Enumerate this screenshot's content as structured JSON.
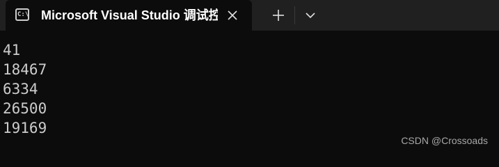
{
  "tab": {
    "icon": "terminal-icon",
    "icon_text": "C:\\",
    "title": "Microsoft Visual Studio 调试控制台",
    "close_icon": "close-icon"
  },
  "toolbar": {
    "new_tab_icon": "plus-icon",
    "dropdown_icon": "chevron-down-icon"
  },
  "console": {
    "lines": [
      "41",
      "18467",
      "6334",
      "26500",
      "19169"
    ]
  },
  "watermark": "CSDN @Crossoads",
  "colors": {
    "tabbar_bg": "#202020",
    "console_bg": "#0c0c0c",
    "console_text": "#cccccc",
    "title_text": "#ffffff"
  }
}
